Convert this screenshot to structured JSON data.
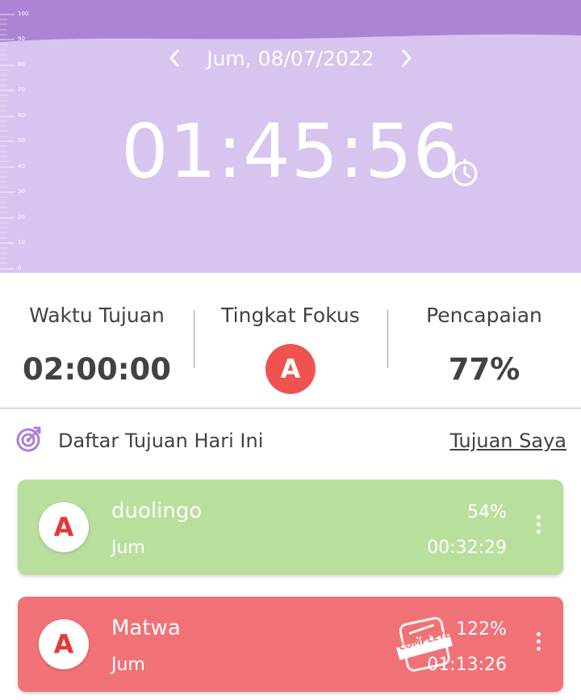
{
  "header": {
    "date": "Jum, 08/07/2022",
    "timer": "01:45:56",
    "ruler_labels": [
      "100",
      "90",
      "80",
      "70",
      "60",
      "50",
      "40",
      "30",
      "20",
      "10",
      "0"
    ],
    "icons": {
      "prev": "chevron-left-icon",
      "next": "chevron-right-icon",
      "timer": "timer-icon"
    },
    "colors": {
      "background": "#d7c5ef",
      "wave": "#ad84d3"
    }
  },
  "stats": {
    "target_time_label": "Waktu Tujuan",
    "target_time_value": "02:00:00",
    "focus_label": "Tingkat Fokus",
    "focus_value": "A",
    "achievement_label": "Pencapaian",
    "achievement_value": "77%"
  },
  "goals": {
    "title": "Daftar Tujuan Hari Ini",
    "link": "Tujuan Saya",
    "items": [
      {
        "grade": "A",
        "name": "duolingo",
        "day": "Jum",
        "percent": "54%",
        "time": "00:32:29",
        "color": "#b8df9c"
      },
      {
        "grade": "A",
        "name": "Matwa",
        "day": "Jum",
        "percent": "122%",
        "time": "01:13:26",
        "color": "#f07277",
        "stamp": "COMPLETE"
      }
    ]
  }
}
